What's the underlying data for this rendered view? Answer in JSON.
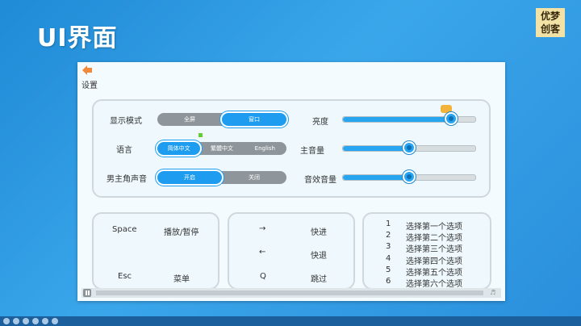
{
  "slide": {
    "title": "UI界面",
    "logo": [
      "优梦",
      "创客"
    ]
  },
  "settings_label": "设置",
  "settings": {
    "display_mode": {
      "label": "显示模式",
      "options": [
        "全屏",
        "窗口"
      ],
      "selected": 1
    },
    "language": {
      "label": "语言",
      "options": [
        "简体中文",
        "繁體中文",
        "English"
      ],
      "selected": 0
    },
    "male_voice": {
      "label": "男主角声音",
      "options": [
        "开启",
        "关闭"
      ],
      "selected": 0
    },
    "brightness": {
      "label": "亮度",
      "value": 0.82
    },
    "main_volume": {
      "label": "主音量",
      "value": 0.5
    },
    "sfx_volume": {
      "label": "音效音量",
      "value": 0.5
    }
  },
  "keys": [
    {
      "key": "Space",
      "action": "播放/暂停"
    },
    {
      "key": "Esc",
      "action": "菜单"
    },
    {
      "key": "→",
      "action": "快进"
    },
    {
      "key": "←",
      "action": "快退"
    },
    {
      "key": "Q",
      "action": "跳过"
    }
  ],
  "choices": [
    {
      "num": "1",
      "text": "选择第一个选项"
    },
    {
      "num": "2",
      "text": "选择第二个选项"
    },
    {
      "num": "3",
      "text": "选择第三个选项"
    },
    {
      "num": "4",
      "text": "选择第四个选项"
    },
    {
      "num": "5",
      "text": "选择第五个选项"
    },
    {
      "num": "6",
      "text": "选择第六个选项"
    }
  ],
  "colors": {
    "accent": "#1e9df0",
    "panel_border": "#cfd8dd",
    "background": "#2a8fdc"
  },
  "icons": [
    "back-arrow-icon",
    "pause-icon",
    "volume-icon",
    "bubble-icon"
  ]
}
